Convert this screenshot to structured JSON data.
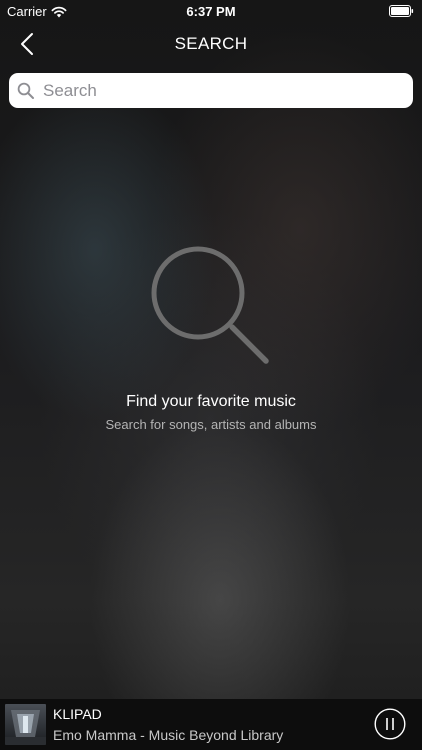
{
  "status_bar": {
    "carrier": "Carrier",
    "time": "6:37 PM"
  },
  "nav": {
    "title": "SEARCH"
  },
  "search": {
    "placeholder": "Search",
    "value": ""
  },
  "empty_state": {
    "title": "Find your favorite music",
    "subtitle": "Search for songs, artists and albums"
  },
  "player": {
    "title": "KLIPAD",
    "subtitle": "Emo Mamma - Music Beyond Library",
    "state": "playing"
  },
  "icons": {
    "back": "chevron-left-icon",
    "search_field": "search-icon",
    "empty_state": "search-icon",
    "wifi": "wifi-icon",
    "battery": "battery-icon",
    "pause": "pause-icon"
  },
  "colors": {
    "background": "#1a1a1a",
    "search_field": "#ffffff",
    "placeholder": "#8e8e93",
    "player_bar": "#0d0d0d"
  }
}
